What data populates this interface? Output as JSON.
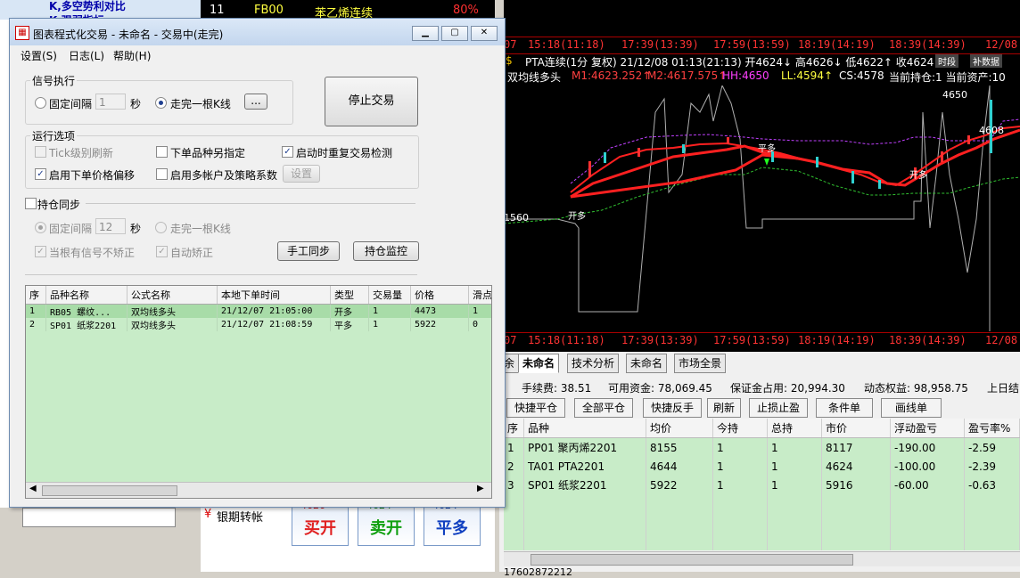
{
  "window": {
    "title": "图表程式化交易 - 未命名 - 交易中(走完)",
    "menu": [
      "设置(S)",
      "日志(L)",
      "帮助(H)"
    ]
  },
  "signal": {
    "group_label": "信号执行",
    "fixed_interval_label": "固定间隔",
    "fixed_interval_value": "1",
    "seconds_unit": "秒",
    "bar_complete_label": "走完一根K线",
    "dots_button": "...",
    "stop_button": "停止交易"
  },
  "run_options": {
    "group_label": "运行选项",
    "tick_refresh": "Tick级别刷新",
    "order_variety": "下单品种另指定",
    "restart_check": "启动时重复交易检测",
    "price_offset": "启用下单价格偏移",
    "multi_account": "启用多帐户及策略系数",
    "settings_button": "设置"
  },
  "position_sync": {
    "label": "持仓同步",
    "fixed_interval_label": "固定间隔",
    "fixed_interval_value": "12",
    "seconds_unit": "秒",
    "bar_complete_label": "走完一根K线",
    "no_correct_label": "当根有信号不矫正",
    "auto_correct_label": "自动矫正",
    "manual_sync_button": "手工同步",
    "monitor_button": "持仓监控"
  },
  "order_table": {
    "columns": [
      "序",
      "品种名称",
      "公式名称",
      "本地下单时间",
      "类型",
      "交易量",
      "价格",
      "滑点"
    ],
    "rows": [
      [
        "1",
        "RB05 螺纹...",
        "双均线多头",
        "21/12/07 21:05:00",
        "开多",
        "1",
        "4473",
        "1"
      ],
      [
        "2",
        "SP01 纸浆2201",
        "双均线多头",
        "21/12/07 21:08:59",
        "平多",
        "1",
        "5922",
        "0"
      ]
    ]
  },
  "background_tree": {
    "item1": "K,多空势利对比",
    "item2": "K,强弱指标"
  },
  "stock_strip": {
    "row_number": "11",
    "code": "FB00",
    "name": "苯乙烯连续",
    "pct": "80%"
  },
  "chart": {
    "time_labels": [
      "07",
      "15:18(11:18)",
      "17:39(13:39)",
      "17:59(13:59)",
      "18:19(14:19)",
      "18:39(14:39)",
      "12/08"
    ],
    "info_line1": "PTA连续(1分 复权) 21/12/08 01:13(21:13) 开4624↓ 高4626↓ 低4622↑ 收4624",
    "info_line2_prefix": "双均线多头",
    "m1": "M1:4623.252↑",
    "m2": "M2:4617.575↑",
    "hh": "HH:4650",
    "ll": "LL:4594↑",
    "cs": "CS:4578",
    "info_tail": "当前持仓:1 当前资产:10",
    "price_4650": "4650",
    "price_4608": "4608",
    "price_1560": "1560",
    "buttons": [
      "时段",
      "补数据"
    ],
    "annotations": [
      "开多",
      "平多",
      "开多"
    ]
  },
  "panel": {
    "tabs": [
      "余",
      "未命名",
      "技术分析",
      "未命名",
      "市场全景"
    ],
    "account_line": [
      "手续费: 38.51",
      "可用资金: 78,069.45",
      "保证金占用: 20,994.30",
      "动态权益: 98,958.75",
      "上日结"
    ],
    "quick_buttons": [
      "快捷平仓",
      "全部平仓",
      "快捷反手",
      "刷新",
      "止损止盈",
      "条件单",
      "画线单"
    ],
    "columns": [
      "序",
      "品种",
      "均价",
      "今持",
      "总持",
      "市价",
      "浮动盈亏",
      "盈亏率%"
    ],
    "rows": [
      [
        "1",
        "PP01 聚丙烯2201",
        "8155",
        "1",
        "1",
        "8117",
        "-190.00",
        "-2.59"
      ],
      [
        "2",
        "TA01 PTA2201",
        "4644",
        "1",
        "1",
        "4624",
        "-100.00",
        "-2.39"
      ],
      [
        "3",
        "SP01 纸浆2201",
        "5922",
        "1",
        "1",
        "5916",
        "-60.00",
        "-0.63"
      ]
    ]
  },
  "order_buttons": {
    "buy_open": "买开",
    "sell_open": "卖开",
    "close_long": "平多",
    "buy_price": "4626",
    "sell_price": "4624",
    "close_price": "4624"
  },
  "bank_transfer": "银期转帐",
  "status_number": "17602872212",
  "colors": {
    "red": "#ff2020",
    "green_row": "#c8ecc8",
    "title_bar": "#c3d6ee"
  }
}
